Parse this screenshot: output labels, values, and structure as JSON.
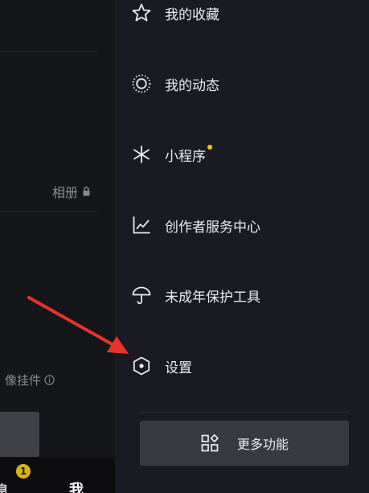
{
  "left_page": {
    "album_label": "相册",
    "widget_label": "像挂件",
    "tab_messages": "息",
    "messages_badge": "1",
    "tab_me": "我"
  },
  "drawer": {
    "items": [
      {
        "label": "我的收藏",
        "icon": "star-icon"
      },
      {
        "label": "我的动态",
        "icon": "activity-ring-icon"
      },
      {
        "label": "小程序",
        "icon": "mini-program-icon",
        "has_dot": true
      },
      {
        "label": "创作者服务中心",
        "icon": "chart-line-icon"
      },
      {
        "label": "未成年保护工具",
        "icon": "umbrella-icon"
      },
      {
        "label": "设置",
        "icon": "hexagon-settings-icon"
      }
    ],
    "more_button_label": "更多功能",
    "more_button_icon": "grid-apps-icon"
  },
  "colors": {
    "drawer_bg": "#1a1b22",
    "accent_dot": "#f5c51b",
    "badge": "#d8b21b",
    "arrow": "#e8332a"
  }
}
